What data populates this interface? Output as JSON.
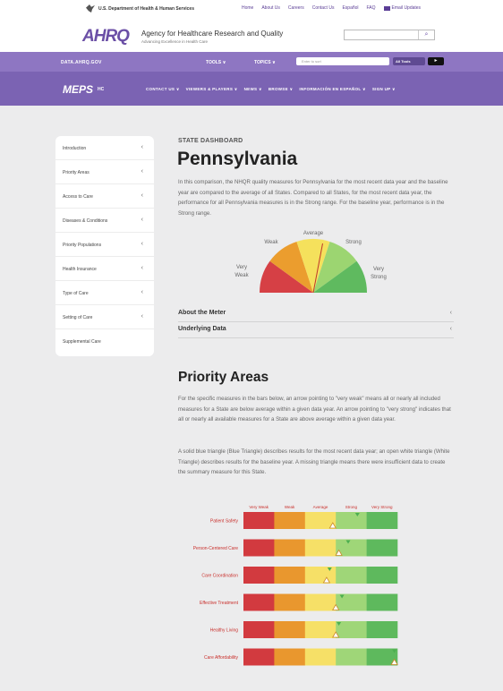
{
  "govbar": {
    "agency": "U.S. Department of Health & Human Services",
    "links": [
      "Home",
      "About Us",
      "Careers",
      "Contact Us",
      "Español",
      "FAQ"
    ],
    "email_updates": "Email Updates"
  },
  "header": {
    "logo": "AHRQ",
    "agency_name": "Agency for Healthcare Research and Quality",
    "tagline": "Advancing Excellence in Health Care",
    "search_placeholder": ""
  },
  "topbar": {
    "site": "DATA.AHRQ.GOV",
    "tools": "TOOLS ∨",
    "topics": "TOPICS ∨",
    "search_placeholder": "Enter to sort",
    "scope": "All Tools",
    "go": "▸"
  },
  "mepsbar": {
    "brand": "MEPS",
    "suffix": "HC",
    "nav": [
      "CONTACT US ∨",
      "VIEWERS & PLAYERS ∨",
      "NEWS ∨",
      "BROWSE ∨",
      "INFORMACIÓN EN ESPAÑOL ∨",
      "SIGN UP ∨"
    ]
  },
  "sidebar": {
    "items": [
      {
        "label": "Introduction",
        "chevron": "‹"
      },
      {
        "label": "Priority Areas",
        "chevron": "‹"
      },
      {
        "label": "Access to Care",
        "chevron": "‹"
      },
      {
        "label": "Diseases & Conditions",
        "chevron": "‹"
      },
      {
        "label": "Priority Populations",
        "chevron": "‹"
      },
      {
        "label": "Health Insurance",
        "chevron": "‹"
      },
      {
        "label": "Type of Care",
        "chevron": "‹"
      },
      {
        "label": "Setting of Care",
        "chevron": "‹"
      },
      {
        "label": "Supplemental Care",
        "chevron": ""
      }
    ]
  },
  "main": {
    "eyebrow": "STATE DASHBOARD",
    "state": "Pennsylvania",
    "intro": "In this comparison, the NHQR quality measures for Pennsylvania for the most recent data year and the baseline year are compared to the average of all States. Compared to all States, for the most recent data year, the performance for all Pennsylvania measures is in the Strong range. For the baseline year, performance is in the Strong range.",
    "meter": {
      "labels": {
        "very_weak": [
          "Very",
          "Weak"
        ],
        "weak": "Weak",
        "average": "Average",
        "strong": "Strong",
        "very_strong": [
          "Very",
          "Strong"
        ]
      },
      "colors": [
        "#d64045",
        "#eb9d2e",
        "#f5e15c",
        "#9cd571",
        "#5fba5f"
      ],
      "needle_level": 0.56
    },
    "accordions": [
      "About the Meter",
      "Underlying Data"
    ],
    "accordion_chevron": "‹",
    "priority_title": "Priority Areas",
    "priority_para1": "For the specific measures in the bars below, an arrow pointing to \"very weak\" means all or nearly all included measures for a State are below average within a given data year. An arrow pointing to \"very strong\" indicates that all or nearly all available measures for a State are above average within a given data year.",
    "priority_para2": "A solid blue triangle (Blue Triangle) describes results for the most recent data year; an open white triangle (White Triangle) describes results for the baseline year. A missing triangle means there were insufficient data to create the summary measure for this State."
  },
  "chart_data": {
    "type": "bar",
    "scale": [
      "Very Weak",
      "Weak",
      "Average",
      "Strong",
      "Very Strong"
    ],
    "colors": [
      "#d23a3f",
      "#e9972e",
      "#f6e067",
      "#9fd678",
      "#5eb95d"
    ],
    "categories": [
      "Patient Safety",
      "Person-Centered Care",
      "Care Coordination",
      "Effective Treatment",
      "Healthy Living",
      "Care Affordability"
    ],
    "markers": {
      "most_recent": [
        3.7,
        3.4,
        2.8,
        3.2,
        3.1,
        4.9
      ],
      "baseline": [
        2.9,
        3.1,
        2.7,
        3.0,
        3.0,
        4.9
      ]
    },
    "marker_colors": {
      "most_recent": "#4caf50",
      "baseline": "#ffffff"
    },
    "label_color": "#c9302c"
  }
}
